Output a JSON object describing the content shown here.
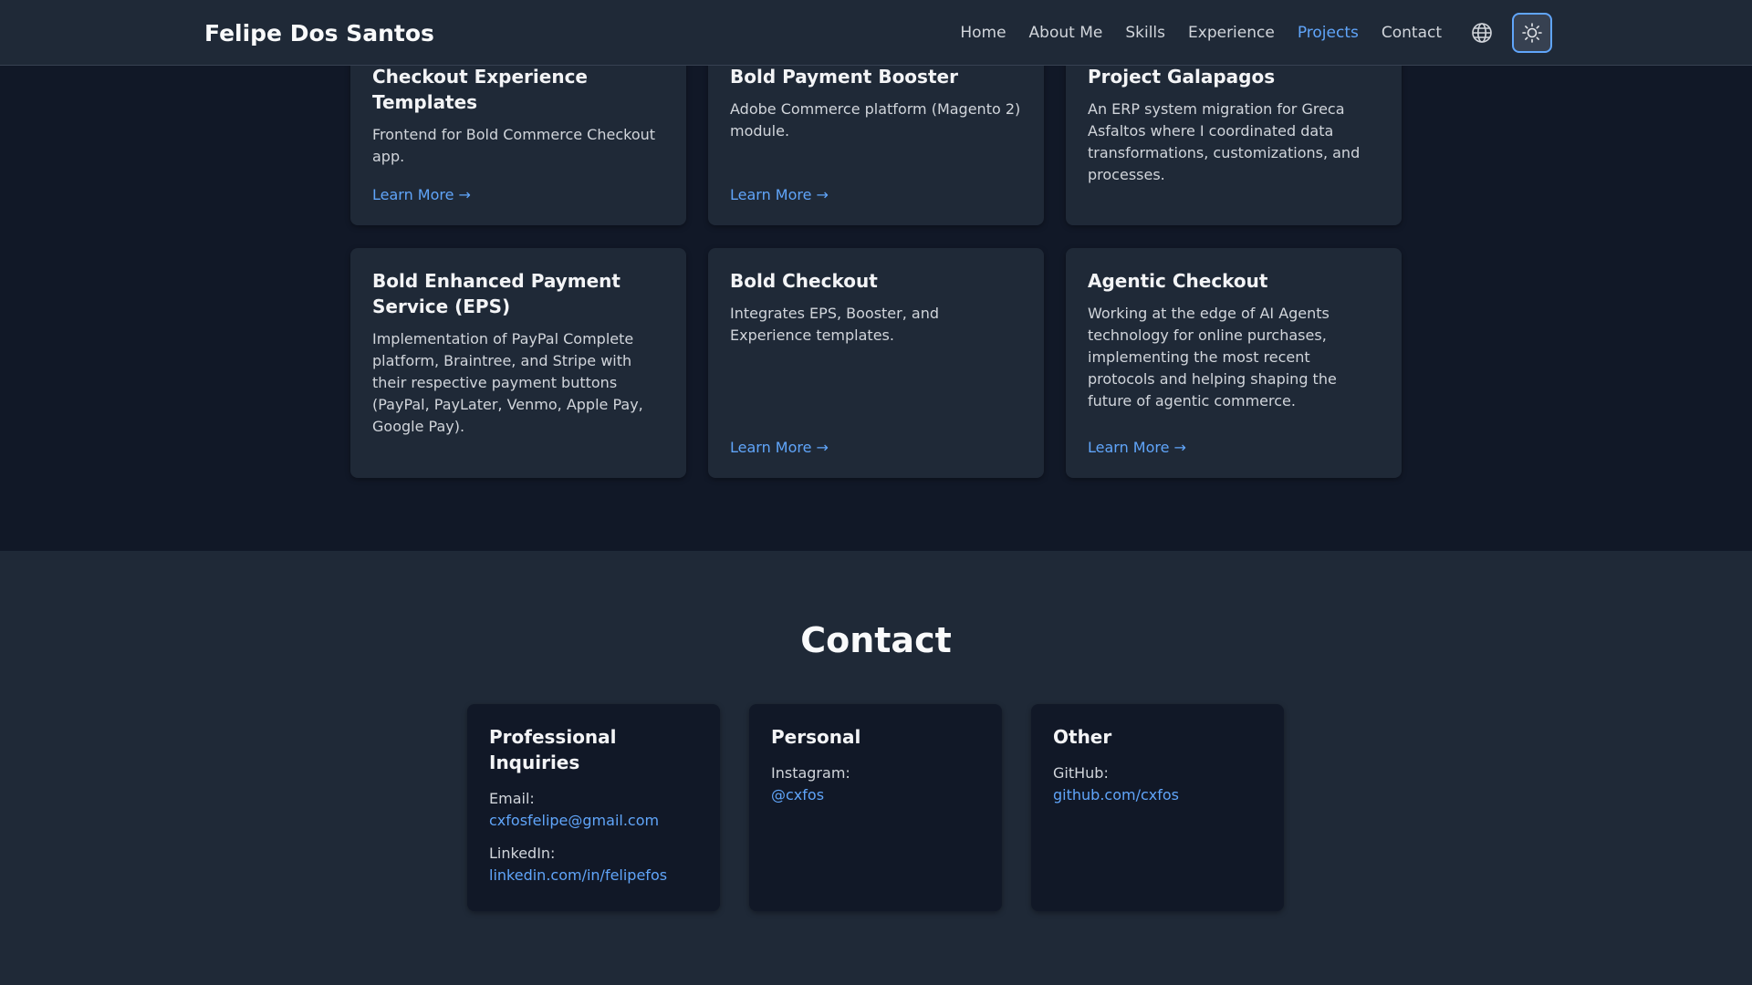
{
  "header": {
    "brand": "Felipe Dos Santos",
    "nav": [
      "Home",
      "About Me",
      "Skills",
      "Experience",
      "Projects",
      "Contact"
    ],
    "active_nav": "Projects",
    "language_icon": "globe-icon",
    "theme_icon": "sun-icon"
  },
  "projects": [
    {
      "title": "Checkout Experience Templates",
      "desc": "Frontend for Bold Commerce Checkout app.",
      "link": "Learn More →"
    },
    {
      "title": "Bold Payment Booster",
      "desc": "Adobe Commerce platform (Magento 2) module.",
      "link": "Learn More →"
    },
    {
      "title": "Project Galapagos",
      "desc": "An ERP system migration for Greca Asfaltos where I coordinated data transformations, customizations, and processes.",
      "link": ""
    },
    {
      "title": "Bold Enhanced Payment Service (EPS)",
      "desc": "Implementation of PayPal Complete platform, Braintree, and Stripe with their respective payment buttons (PayPal, PayLater, Venmo, Apple Pay, Google Pay).",
      "link": ""
    },
    {
      "title": "Bold Checkout",
      "desc": "Integrates EPS, Booster, and Experience templates.",
      "link": "Learn More →"
    },
    {
      "title": "Agentic Checkout",
      "desc": "Working at the edge of AI Agents technology for online purchases, implementing the most recent protocols and helping shaping the future of agentic commerce.",
      "link": "Learn More →"
    }
  ],
  "contact": {
    "title": "Contact",
    "professional": {
      "title": "Professional Inquiries",
      "email_label": "Email:",
      "email": "cxfosfelipe@gmail.com",
      "linkedin_label": "LinkedIn:",
      "linkedin": "linkedin.com/in/felipefos"
    },
    "personal": {
      "title": "Personal",
      "instagram_label": "Instagram:",
      "instagram": "@cxfos"
    },
    "other": {
      "title": "Other",
      "github_label": "GitHub:",
      "github": "github.com/cxfos"
    }
  },
  "colors": {
    "accent": "#60a5fa",
    "page_bg": "#111827",
    "card_bg": "#1f2937"
  }
}
